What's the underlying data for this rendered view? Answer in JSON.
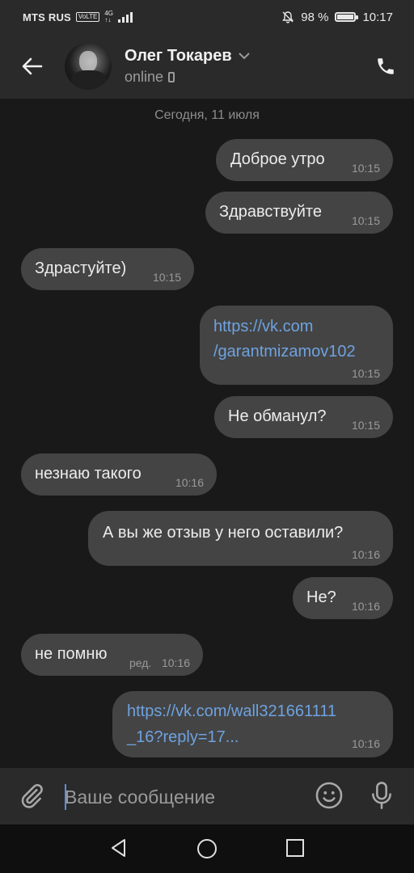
{
  "status_bar": {
    "carrier": "MTS RUS",
    "volte": "VoLTE",
    "network": "4G",
    "battery": "98 %",
    "battery_level": 0.98,
    "time": "10:17"
  },
  "header": {
    "contact_name": "Олег Токарев",
    "status": "online"
  },
  "chat": {
    "date": "Сегодня, 11 июля",
    "messages": [
      {
        "dir": "out",
        "text": "Доброе утро",
        "time": "10:15"
      },
      {
        "dir": "out",
        "text": "Здравствуйте",
        "time": "10:15"
      },
      {
        "dir": "in",
        "text": "Здрастуйте)",
        "time": "10:15"
      },
      {
        "dir": "out",
        "line1": "https://vk.com",
        "line2": "/garantmizamov102",
        "time": "10:15"
      },
      {
        "dir": "out",
        "text": "Не обманул?",
        "time": "10:15"
      },
      {
        "dir": "in",
        "text": "незнаю такого",
        "time": "10:16"
      },
      {
        "dir": "out",
        "text": "А вы же отзыв у него оставили?",
        "time": "10:16"
      },
      {
        "dir": "out",
        "text": "Не?",
        "time": "10:16"
      },
      {
        "dir": "in",
        "text": "не помню",
        "edited": "ред.",
        "time": "10:16"
      },
      {
        "dir": "out",
        "line1": "https://vk.com/wall321661111",
        "line2": "_16?reply=17...",
        "time": "10:16"
      }
    ]
  },
  "composer": {
    "placeholder": "Ваше сообщение"
  },
  "colors": {
    "background": "#191919",
    "bar": "#2a2a2a",
    "bubble": "#444444",
    "link": "#6ea2e0"
  },
  "icons": [
    "back-arrow-icon",
    "chevron-down-icon",
    "phone-icon",
    "attach-icon",
    "emoji-icon",
    "mic-icon",
    "nav-back-icon",
    "nav-home-icon",
    "nav-recents-icon"
  ]
}
